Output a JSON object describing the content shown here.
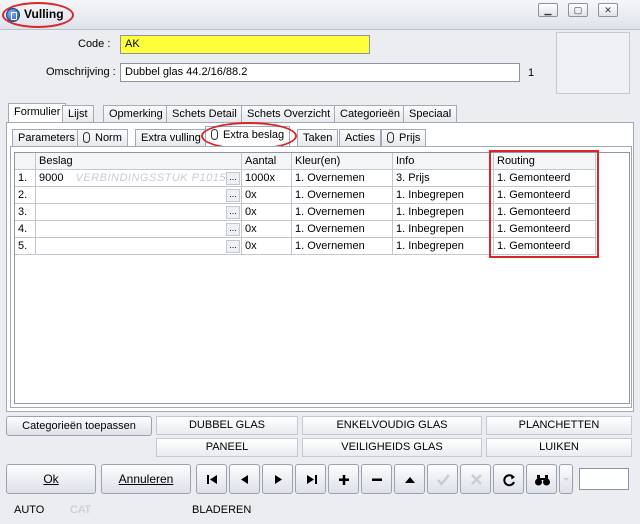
{
  "window": {
    "title": "Vulling"
  },
  "header": {
    "code_label": "Code :",
    "code_value": "AK",
    "omschrijving_label": "Omschrijving :",
    "omschrijving_value": "Dubbel glas 44.2/16/88.2",
    "omschrijving_count": "1"
  },
  "main_tabs": [
    "Formulier",
    "Lijst",
    "Opmerking",
    "Schets Detail",
    "Schets Overzicht",
    "Categorieën",
    "Speciaal"
  ],
  "sub_tabs": [
    "Parameters",
    "Norm",
    "Extra vulling",
    "Extra beslag",
    "Taken",
    "Acties",
    "Prijs"
  ],
  "grid": {
    "columns": [
      "Beslag",
      "Aantal",
      "Kleur(en)",
      "Info",
      "Routing"
    ],
    "rows": [
      {
        "nr": "1.",
        "beslag": "9000",
        "beslag_desc": "VERBINDINGSSTUK P1015",
        "aantal": "1000x",
        "kleur": "1. Overnemen",
        "info": "3. Prijs",
        "routing": "1. Gemonteerd"
      },
      {
        "nr": "2.",
        "beslag": "",
        "beslag_desc": "",
        "aantal": "0x",
        "kleur": "1. Overnemen",
        "info": "1. Inbegrepen",
        "routing": "1. Gemonteerd"
      },
      {
        "nr": "3.",
        "beslag": "",
        "beslag_desc": "",
        "aantal": "0x",
        "kleur": "1. Overnemen",
        "info": "1. Inbegrepen",
        "routing": "1. Gemonteerd"
      },
      {
        "nr": "4.",
        "beslag": "",
        "beslag_desc": "",
        "aantal": "0x",
        "kleur": "1. Overnemen",
        "info": "1. Inbegrepen",
        "routing": "1. Gemonteerd"
      },
      {
        "nr": "5.",
        "beslag": "",
        "beslag_desc": "",
        "aantal": "0x",
        "kleur": "1. Overnemen",
        "info": "1. Inbegrepen",
        "routing": "1. Gemonteerd"
      }
    ],
    "dots_label": "..."
  },
  "categories": {
    "apply_label": "Categorieën toepassen",
    "row1": [
      "DUBBEL GLAS",
      "ENKELVOUDIG GLAS",
      "PLANCHETTEN"
    ],
    "row2": [
      "PANEEL",
      "VEILIGHEIDS GLAS",
      "LUIKEN"
    ]
  },
  "toolbar": {
    "ok_label": "Ok",
    "cancel_label": "Annuleren",
    "icons": [
      "first-icon",
      "previous-icon",
      "next-icon",
      "last-icon",
      "add-icon",
      "delete-icon",
      "up-icon",
      "confirm-icon",
      "cancel-icon",
      "refresh-icon",
      "binoculars-icon",
      "dropdown-icon"
    ]
  },
  "status": {
    "auto": "AUTO",
    "cat": "CAT",
    "mode": "BLADEREN"
  },
  "colors": {
    "code_bg": "#ffff3a",
    "annotation": "#d9262b"
  }
}
